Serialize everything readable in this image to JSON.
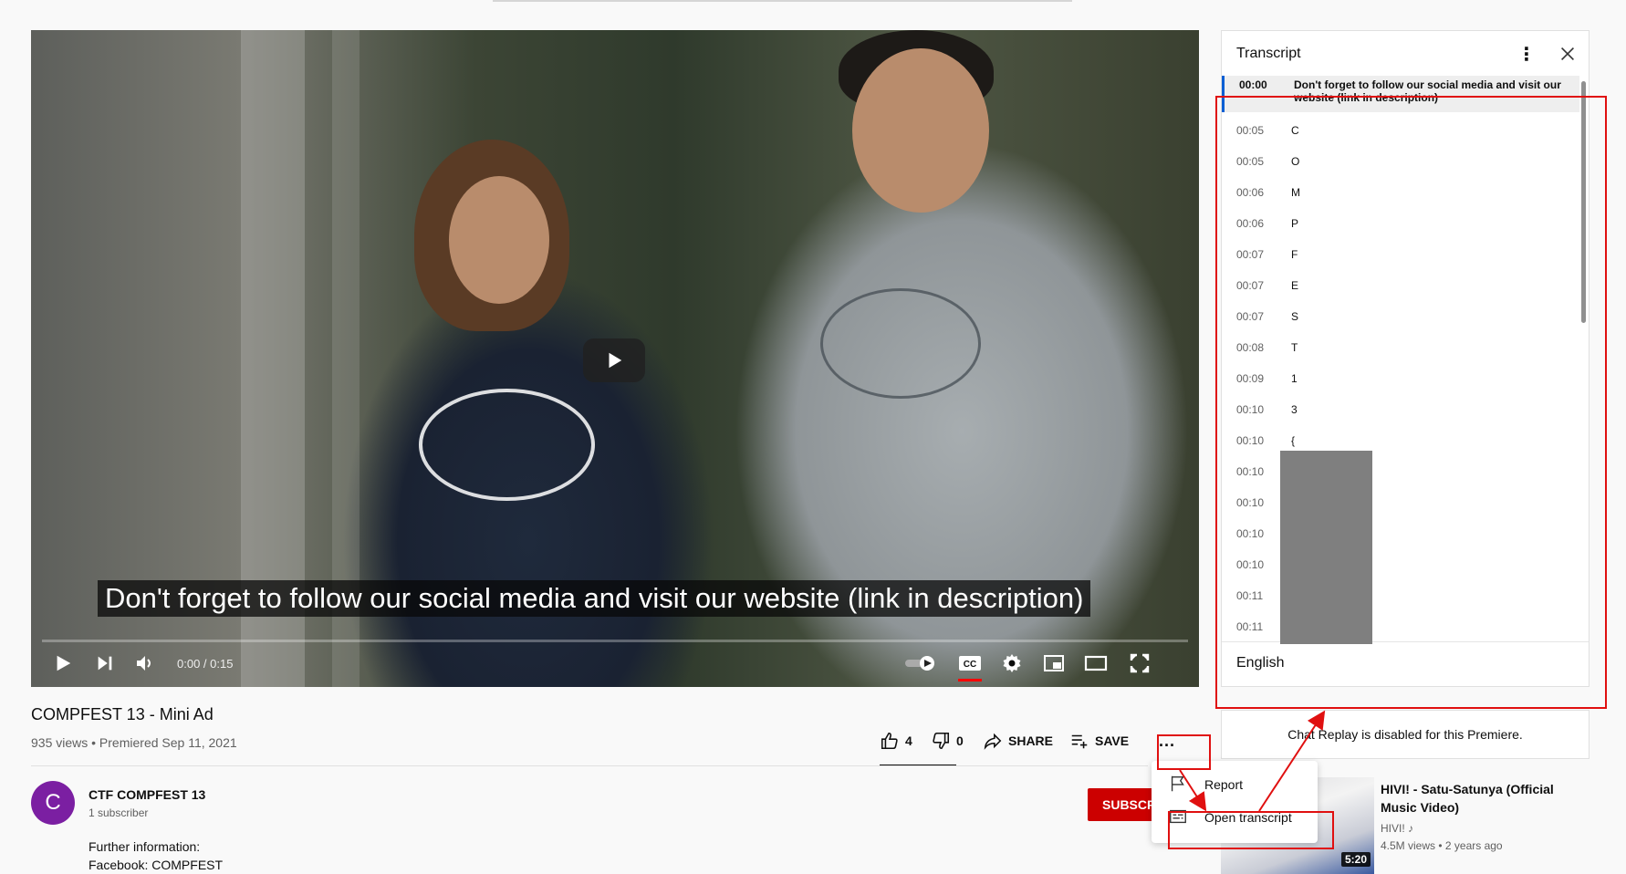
{
  "video": {
    "caption": "Don't forget to follow our social media and visit our website (link in description)",
    "time_display": "0:00 / 0:15",
    "title": "COMPFEST 13 - Mini Ad",
    "stats": "935 views • Premiered Sep 11, 2021"
  },
  "actions": {
    "like_count": "4",
    "dislike_count": "0",
    "share_label": "SHARE",
    "save_label": "SAVE",
    "more_label": "..."
  },
  "channel": {
    "avatar_letter": "C",
    "name": "CTF COMPFEST 13",
    "subscribers": "1 subscriber",
    "subscribe_label": "SUBSCRIBE",
    "avatar_color": "#7b1fa2"
  },
  "description": {
    "line1": "Further information:",
    "line2": "Facebook: COMPFEST"
  },
  "menu": {
    "report_label": "Report",
    "open_transcript_label": "Open transcript"
  },
  "transcript": {
    "title": "Transcript",
    "language": "English",
    "rows": [
      {
        "time": "00:00",
        "text": "Don't forget to follow our social media and visit our website (link in description)"
      },
      {
        "time": "00:05",
        "text": "C"
      },
      {
        "time": "00:05",
        "text": "O"
      },
      {
        "time": "00:06",
        "text": "M"
      },
      {
        "time": "00:06",
        "text": "P"
      },
      {
        "time": "00:07",
        "text": "F"
      },
      {
        "time": "00:07",
        "text": "E"
      },
      {
        "time": "00:07",
        "text": "S"
      },
      {
        "time": "00:08",
        "text": "T"
      },
      {
        "time": "00:09",
        "text": "1"
      },
      {
        "time": "00:10",
        "text": "3"
      },
      {
        "time": "00:10",
        "text": "{"
      },
      {
        "time": "00:10",
        "text": ""
      },
      {
        "time": "00:10",
        "text": ""
      },
      {
        "time": "00:10",
        "text": ""
      },
      {
        "time": "00:10",
        "text": ""
      },
      {
        "time": "00:11",
        "text": ""
      },
      {
        "time": "00:11",
        "text": ""
      }
    ]
  },
  "chat": {
    "message": "Chat Replay is disabled for this Premiere."
  },
  "recommended": {
    "title": "HIVI! - Satu-Satunya (Official Music Video)",
    "channel": "HIVI!",
    "meta": "4.5M views • 2 years ago",
    "duration": "5:20"
  },
  "colors": {
    "accent_red": "#cc0000",
    "annotation_red": "#e01010",
    "active_row_marker": "#065fd4"
  }
}
